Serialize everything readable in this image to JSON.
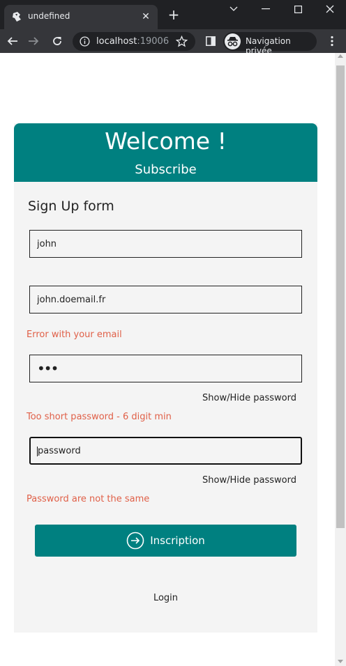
{
  "browser": {
    "tab_title": "undefined",
    "url_host": "localhost",
    "url_port": ":19006",
    "incognito_label": "Navigation privée"
  },
  "header": {
    "title": "Welcome !",
    "subtitle": "Subscribe"
  },
  "form": {
    "title": "Sign Up form",
    "name_value": "john",
    "email_value": "john.doemail.fr",
    "email_error": "Error with your email",
    "password_masked": "•••",
    "password_toggle": "Show/Hide password",
    "password_error": "Too short password - 6 digit min",
    "confirm_placeholder": "password",
    "confirm_toggle": "Show/Hide password",
    "confirm_error": "Password are not the same",
    "submit_label": "Inscription",
    "login_label": "Login"
  },
  "colors": {
    "accent": "#008080",
    "error": "#e06048",
    "card_bg": "#f4f4f4"
  }
}
